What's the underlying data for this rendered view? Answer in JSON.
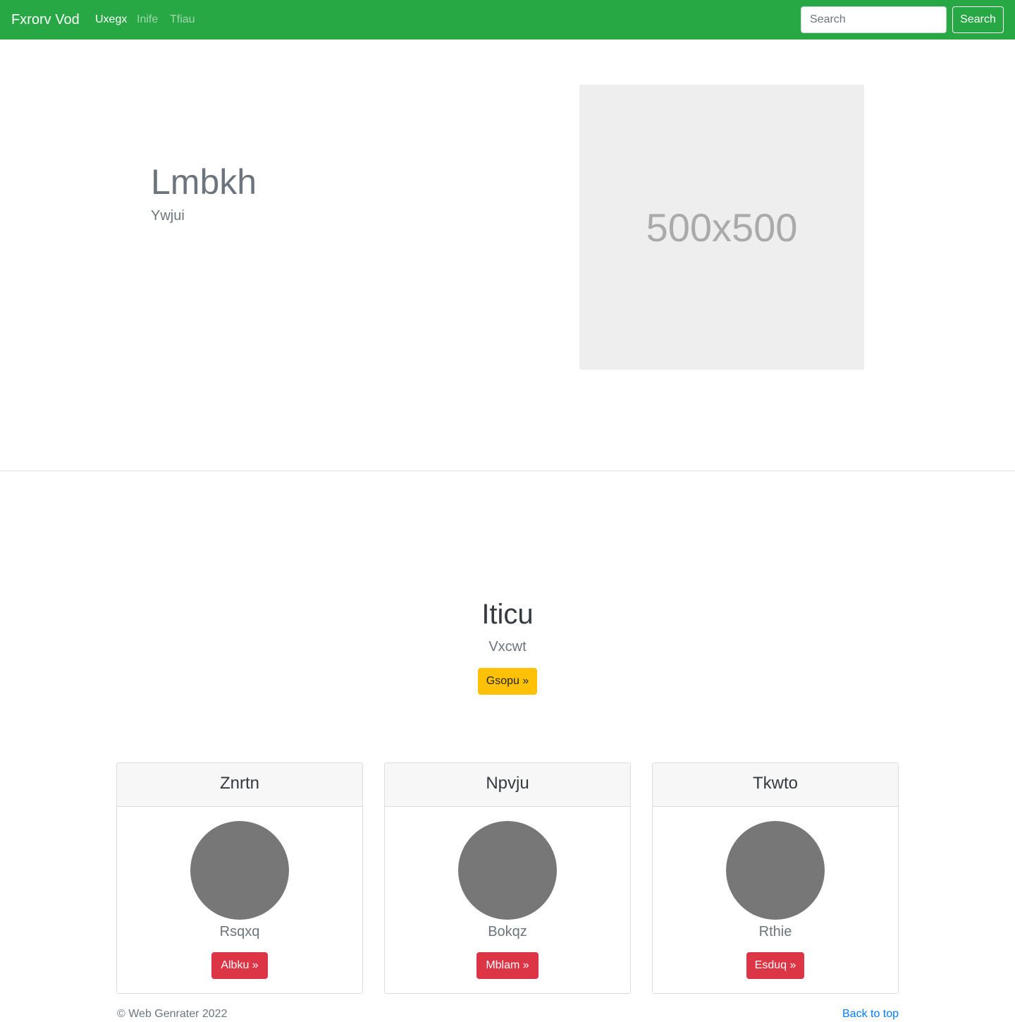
{
  "navbar": {
    "brand": "Fxrorv Vod",
    "links": [
      {
        "label": "Uxegx"
      },
      {
        "label": "Inife"
      },
      {
        "label": "Tfiau"
      }
    ],
    "search_placeholder": "Search",
    "search_button": "Search"
  },
  "hero": {
    "title": "Lmbkh",
    "subtitle": "Ywjui",
    "image_label": "500x500"
  },
  "section": {
    "title": "Iticu",
    "subtitle": "Vxcwt",
    "button": "Gsopu »"
  },
  "cards": [
    {
      "title": "Znrtn",
      "name": "Rsqxq",
      "button": "Albku »"
    },
    {
      "title": "Npvju",
      "name": "Bokqz",
      "button": "Mblam »"
    },
    {
      "title": "Tkwto",
      "name": "Rthie",
      "button": "Esduq »"
    }
  ],
  "footer": {
    "copyright": "© Web Genrater 2022",
    "back_to_top": "Back to top"
  },
  "colors": {
    "navbar": "#28a745",
    "cta": "#ffc107",
    "card_button": "#dc3545",
    "link": "#007bff"
  }
}
